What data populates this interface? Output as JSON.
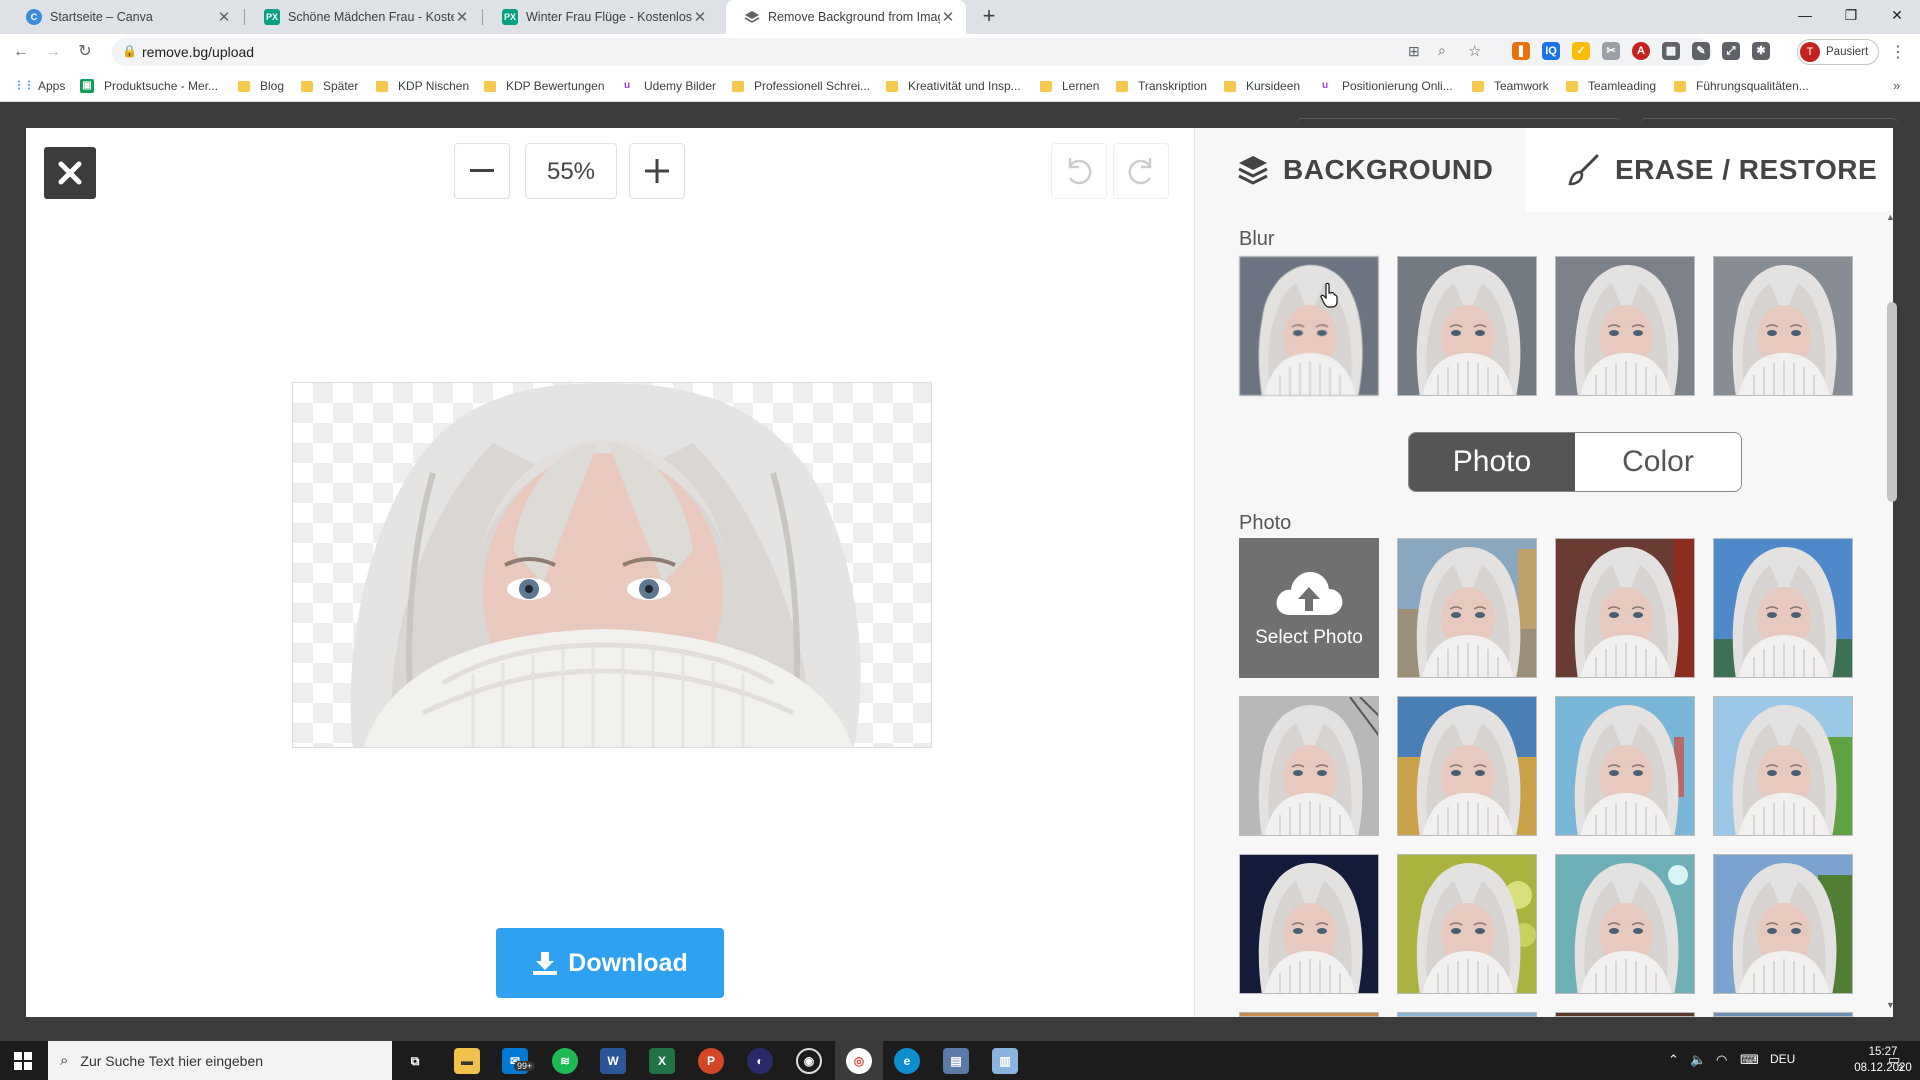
{
  "browser": {
    "tabs": [
      {
        "title": "Startseite – Canva",
        "favicon": "canva-icon",
        "active": false
      },
      {
        "title": "Schöne Mädchen Frau - Kostenlo",
        "favicon": "pexels-icon",
        "active": false
      },
      {
        "title": "Winter Frau Flüge - Kostenloses F",
        "favicon": "pexels-icon",
        "active": false
      },
      {
        "title": "Remove Background from Image",
        "favicon": "removebg-icon",
        "active": true
      }
    ],
    "new_tab": "+",
    "url": "remove.bg/upload",
    "profile_initial": "T",
    "profile_label": "Pausiert",
    "bookmarks": [
      "Apps",
      "Produktsuche - Mer...",
      "Blog",
      "Später",
      "KDP Nischen",
      "KDP Bewertungen",
      "Udemy Bilder",
      "Professionell Schrei...",
      "Kreativität und Insp...",
      "Lernen",
      "Transkription",
      "Kursideen",
      "Positionierung Onli...",
      "Teamwork",
      "Teamleading",
      "Führungsqualitäten..."
    ]
  },
  "editor": {
    "zoom_level": "55%",
    "download_label": "Download",
    "panel": {
      "tab_background": "BACKGROUND",
      "tab_erase": "ERASE / RESTORE",
      "blur_label": "Blur",
      "toggle_photo": "Photo",
      "toggle_color": "Color",
      "photo_label": "Photo",
      "select_photo": "Select Photo"
    }
  },
  "taskbar": {
    "search_placeholder": "Zur Suche Text hier eingeben",
    "mail_badge": "99+",
    "language": "DEU",
    "time": "15:27",
    "date": "08.12.2020",
    "notifications": "3"
  },
  "colors": {
    "accent_blue": "#2ea2f1",
    "toggle_active": "#555555",
    "dark_bg": "#3c3c3c"
  }
}
